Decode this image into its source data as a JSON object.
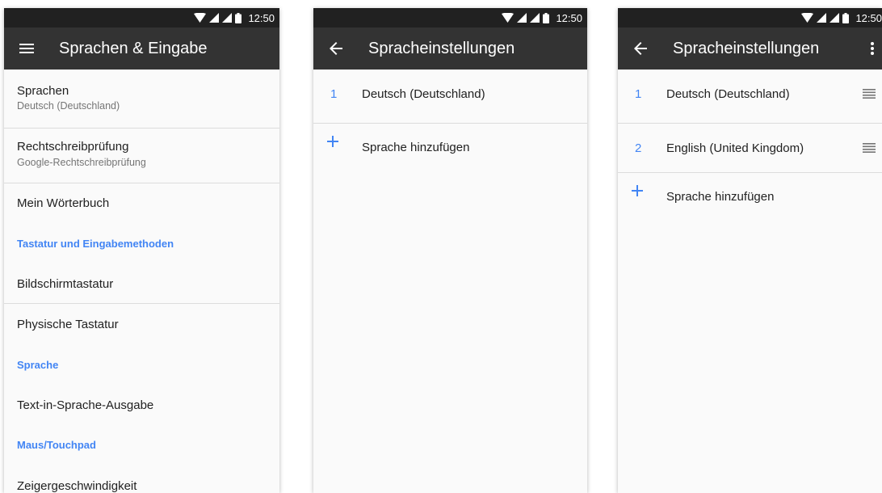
{
  "status_bar": {
    "time": "12:50",
    "icons": [
      "wifi-icon",
      "signal-icon",
      "signal-icon",
      "battery-icon"
    ]
  },
  "colors": {
    "accent": "#4285f4",
    "appbar": "#333333",
    "statusbar": "#212121"
  },
  "screen1": {
    "title": "Sprachen & Eingabe",
    "nav_icon": "hamburger-menu-icon",
    "items": [
      {
        "primary": "Sprachen",
        "secondary": "Deutsch (Deutschland)"
      },
      {
        "primary": "Rechtschreibprüfung",
        "secondary": "Google-Rechtschreibprüfung"
      },
      {
        "primary": "Mein Wörterbuch"
      }
    ],
    "header_keyboard": "Tastatur und Eingabemethoden",
    "keyboard_items": [
      "Bildschirmtastatur",
      "Physische Tastatur"
    ],
    "header_speech": "Sprache",
    "speech_items": [
      "Text-in-Sprache-Ausgabe"
    ],
    "header_mouse": "Maus/Touchpad",
    "mouse_items": [
      "Zeigergeschwindigkeit"
    ]
  },
  "screen2": {
    "title": "Spracheinstellungen",
    "nav_icon": "back-arrow-icon",
    "languages": [
      {
        "num": "1",
        "name": "Deutsch (Deutschland)"
      }
    ],
    "add_label": "Sprache hinzufügen"
  },
  "screen3": {
    "title": "Spracheinstellungen",
    "nav_icon": "back-arrow-icon",
    "menu_icon": "more-vert-icon",
    "languages": [
      {
        "num": "1",
        "name": "Deutsch (Deutschland)"
      },
      {
        "num": "2",
        "name": "English (United Kingdom)"
      }
    ],
    "add_label": "Sprache hinzufügen"
  }
}
